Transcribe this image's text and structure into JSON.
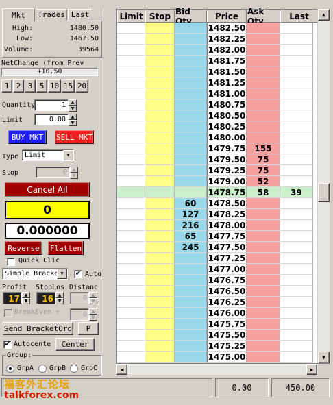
{
  "tabs": [
    "Mkt",
    "Trades",
    "Last"
  ],
  "stats": [
    {
      "label": "High:",
      "value": "1480.50"
    },
    {
      "label": "Low:",
      "value": "1467.50"
    },
    {
      "label": "Volume:",
      "value": "39564"
    }
  ],
  "net_change": {
    "label": "NetChange (from Prev",
    "value": "+10.50"
  },
  "qty_buttons": [
    "1",
    "2",
    "3",
    "5",
    "10",
    "15",
    "20"
  ],
  "quantity": {
    "label": "Quantity",
    "value": "1"
  },
  "limit": {
    "label": "Limit",
    "value": "0.00"
  },
  "buy_mkt": "BUY MKT",
  "sell_mkt": "SELL MKT",
  "type": {
    "label": "Type",
    "value": "Limit"
  },
  "stop": {
    "label": "Stop",
    "value": "0"
  },
  "cancel_all": "Cancel All",
  "position": "0",
  "pnl": "0.000000",
  "reverse": "Reverse",
  "flatten": "Flatten",
  "quick_click": "Quick Clic",
  "bracket": {
    "select": "Simple Bracke",
    "auto_label": "Auto",
    "auto_checked": true
  },
  "profit": {
    "label": "Profit",
    "value": "17"
  },
  "stoploss": {
    "label": "StopLos",
    "value": "16"
  },
  "distance": {
    "label": "Distanc",
    "value": "0"
  },
  "breakeven": {
    "label": "BreakEven +",
    "value": "0"
  },
  "send_bracket": "Send BracketOrd",
  "p_button": "P",
  "autocenter": {
    "label": "Autocente",
    "checked": true
  },
  "center": "Center",
  "group": {
    "label": "Group:",
    "options": [
      "GrpA",
      "GrpB",
      "GrpC"
    ],
    "selected": 0
  },
  "status": {
    "left": "0.00",
    "right": "450.00"
  },
  "watermark": {
    "cn": "福客外汇论坛",
    "en": "talkforex.com"
  },
  "ladder": {
    "headers": [
      "Limit",
      "Stop",
      "Bid Qty",
      "Price",
      "Ask Qty",
      "Last"
    ],
    "rows": [
      {
        "price": "1482.50",
        "bid": "",
        "ask": "",
        "last": ""
      },
      {
        "price": "1482.25",
        "bid": "",
        "ask": "",
        "last": ""
      },
      {
        "price": "1482.00",
        "bid": "",
        "ask": "",
        "last": ""
      },
      {
        "price": "1481.75",
        "bid": "",
        "ask": "",
        "last": ""
      },
      {
        "price": "1481.50",
        "bid": "",
        "ask": "",
        "last": ""
      },
      {
        "price": "1481.25",
        "bid": "",
        "ask": "",
        "last": ""
      },
      {
        "price": "1481.00",
        "bid": "",
        "ask": "",
        "last": ""
      },
      {
        "price": "1480.75",
        "bid": "",
        "ask": "",
        "last": ""
      },
      {
        "price": "1480.50",
        "bid": "",
        "ask": "",
        "last": ""
      },
      {
        "price": "1480.25",
        "bid": "",
        "ask": "",
        "last": ""
      },
      {
        "price": "1480.00",
        "bid": "",
        "ask": "",
        "last": ""
      },
      {
        "price": "1479.75",
        "bid": "",
        "ask": "155",
        "last": ""
      },
      {
        "price": "1479.50",
        "bid": "",
        "ask": "75",
        "last": ""
      },
      {
        "price": "1479.25",
        "bid": "",
        "ask": "75",
        "last": ""
      },
      {
        "price": "1479.00",
        "bid": "",
        "ask": "52",
        "last": ""
      },
      {
        "price": "1478.75",
        "bid": "",
        "ask": "58",
        "last": "39",
        "current": true
      },
      {
        "price": "1478.50",
        "bid": "60",
        "ask": "",
        "last": ""
      },
      {
        "price": "1478.25",
        "bid": "127",
        "ask": "",
        "last": ""
      },
      {
        "price": "1478.00",
        "bid": "216",
        "ask": "",
        "last": ""
      },
      {
        "price": "1477.75",
        "bid": "65",
        "ask": "",
        "last": ""
      },
      {
        "price": "1477.50",
        "bid": "245",
        "ask": "",
        "last": ""
      },
      {
        "price": "1477.25",
        "bid": "",
        "ask": "",
        "last": ""
      },
      {
        "price": "1477.00",
        "bid": "",
        "ask": "",
        "last": ""
      },
      {
        "price": "1476.75",
        "bid": "",
        "ask": "",
        "last": ""
      },
      {
        "price": "1476.50",
        "bid": "",
        "ask": "",
        "last": ""
      },
      {
        "price": "1476.25",
        "bid": "",
        "ask": "",
        "last": ""
      },
      {
        "price": "1476.00",
        "bid": "",
        "ask": "",
        "last": ""
      },
      {
        "price": "1475.75",
        "bid": "",
        "ask": "",
        "last": ""
      },
      {
        "price": "1475.50",
        "bid": "",
        "ask": "",
        "last": ""
      },
      {
        "price": "1475.25",
        "bid": "",
        "ask": "",
        "last": ""
      },
      {
        "price": "1475.00",
        "bid": "",
        "ask": "",
        "last": ""
      }
    ]
  }
}
